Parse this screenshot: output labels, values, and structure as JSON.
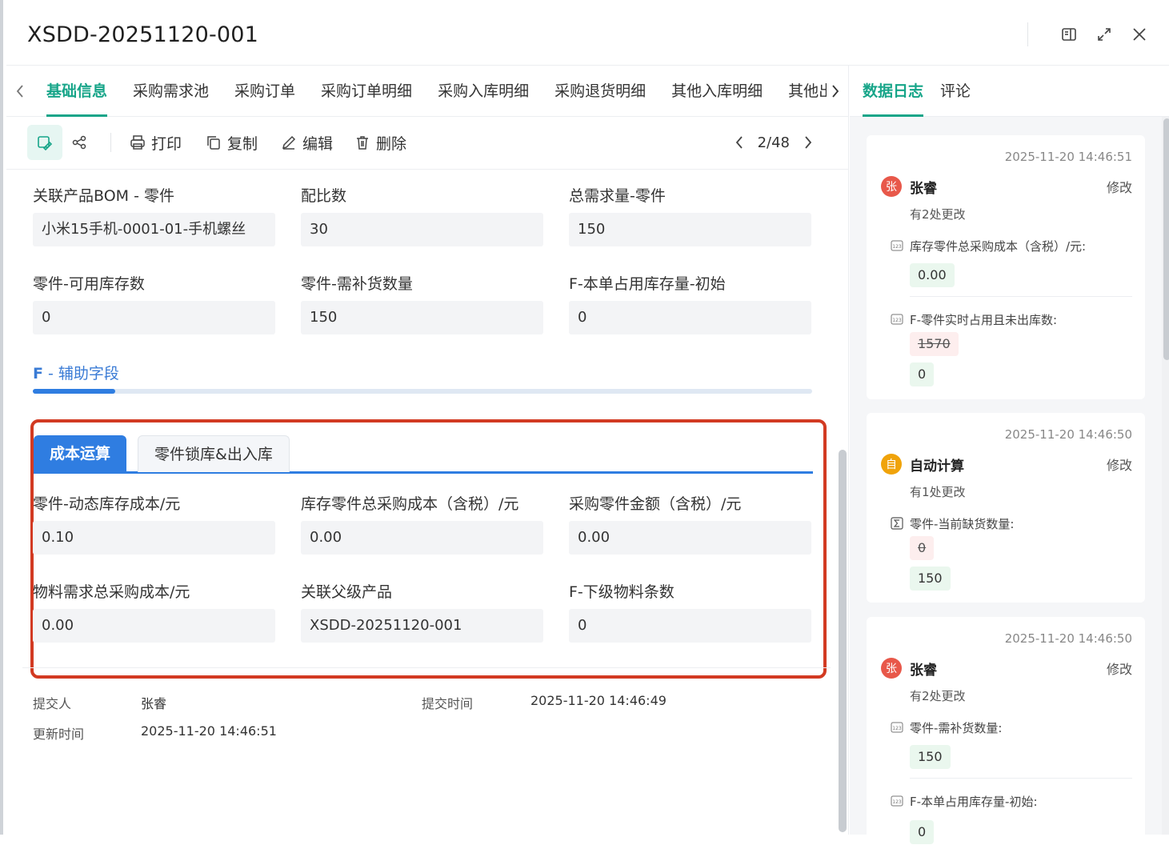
{
  "window": {
    "title": "XSDD-20251120-001",
    "icons": [
      "sidebar-panel-icon",
      "expand-icon",
      "close-icon"
    ]
  },
  "tabs": {
    "items": [
      {
        "label": "基础信息",
        "active": true
      },
      {
        "label": "采购需求池"
      },
      {
        "label": "采购订单"
      },
      {
        "label": "采购订单明细"
      },
      {
        "label": "采购入库明细"
      },
      {
        "label": "采购退货明细"
      },
      {
        "label": "其他入库明细"
      },
      {
        "label": "其他出"
      }
    ]
  },
  "toolbar": {
    "print": "打印",
    "copy": "复制",
    "edit": "编辑",
    "delete": "删除",
    "pager": "2/48"
  },
  "fields_top": [
    {
      "label": "关联产品BOM - 零件",
      "value": "小米15手机-0001-01-手机螺丝"
    },
    {
      "label": "配比数",
      "value": "30"
    },
    {
      "label": "总需求量-零件",
      "value": "150"
    },
    {
      "label": "零件-可用库存数",
      "value": "0"
    },
    {
      "label": "零件-需补货数量",
      "value": "150"
    },
    {
      "label": "F-本单占用库存量-初始",
      "value": "0"
    }
  ],
  "section": {
    "prefix": "F",
    "title": " - 辅助字段"
  },
  "subtabs": {
    "active": "成本运算",
    "inactive": "零件锁库&出入库"
  },
  "fields_cost": [
    {
      "label": "零件-动态库存成本/元",
      "value": "0.10"
    },
    {
      "label": "库存零件总采购成本（含税）/元",
      "value": "0.00"
    },
    {
      "label": "采购零件金额（含税）/元",
      "value": "0.00"
    },
    {
      "label": "物料需求总采购成本/元",
      "value": "0.00"
    },
    {
      "label": "关联父级产品",
      "value": "XSDD-20251120-001"
    },
    {
      "label": "F-下级物料条数",
      "value": "0"
    }
  ],
  "meta": {
    "submitter_label": "提交人",
    "submitter": "张睿",
    "submit_time_label": "提交时间",
    "submit_time": "2025-11-20 14:46:49",
    "update_time_label": "更新时间",
    "update_time": "2025-11-20 14:46:51"
  },
  "right_tabs": {
    "log": "数据日志",
    "comment": "评论"
  },
  "logs": [
    {
      "time": "2025-11-20 14:46:51",
      "avatar": "张",
      "avatar_color": "#e8584a",
      "user": "张睿",
      "action": "修改",
      "count": "有2处更改",
      "changes": [
        {
          "field": "库存零件总采购成本（含税）/元:",
          "icon": "number-field-icon",
          "new": "0.00"
        },
        {
          "field": "F-零件实时占用且未出库数:",
          "icon": "number-field-icon",
          "old": "1570",
          "new": "0"
        }
      ]
    },
    {
      "time": "2025-11-20 14:46:50",
      "avatar": "自",
      "avatar_color": "#f0a30a",
      "user": "自动计算",
      "action": "修改",
      "count": "有1处更改",
      "changes": [
        {
          "field": "零件-当前缺货数量:",
          "icon": "sum-field-icon",
          "old": "0",
          "new": "150"
        }
      ]
    },
    {
      "time": "2025-11-20 14:46:50",
      "avatar": "张",
      "avatar_color": "#e8584a",
      "user": "张睿",
      "action": "修改",
      "count": "有2处更改",
      "changes": [
        {
          "field": "零件-需补货数量:",
          "icon": "number-field-icon",
          "new": "150"
        },
        {
          "field": "F-本单占用库存量-初始:",
          "icon": "number-field-icon",
          "new": "0"
        }
      ]
    }
  ],
  "colors": {
    "accent": "#17a589",
    "blue": "#2f7de1",
    "highlight": "#d23a22"
  }
}
